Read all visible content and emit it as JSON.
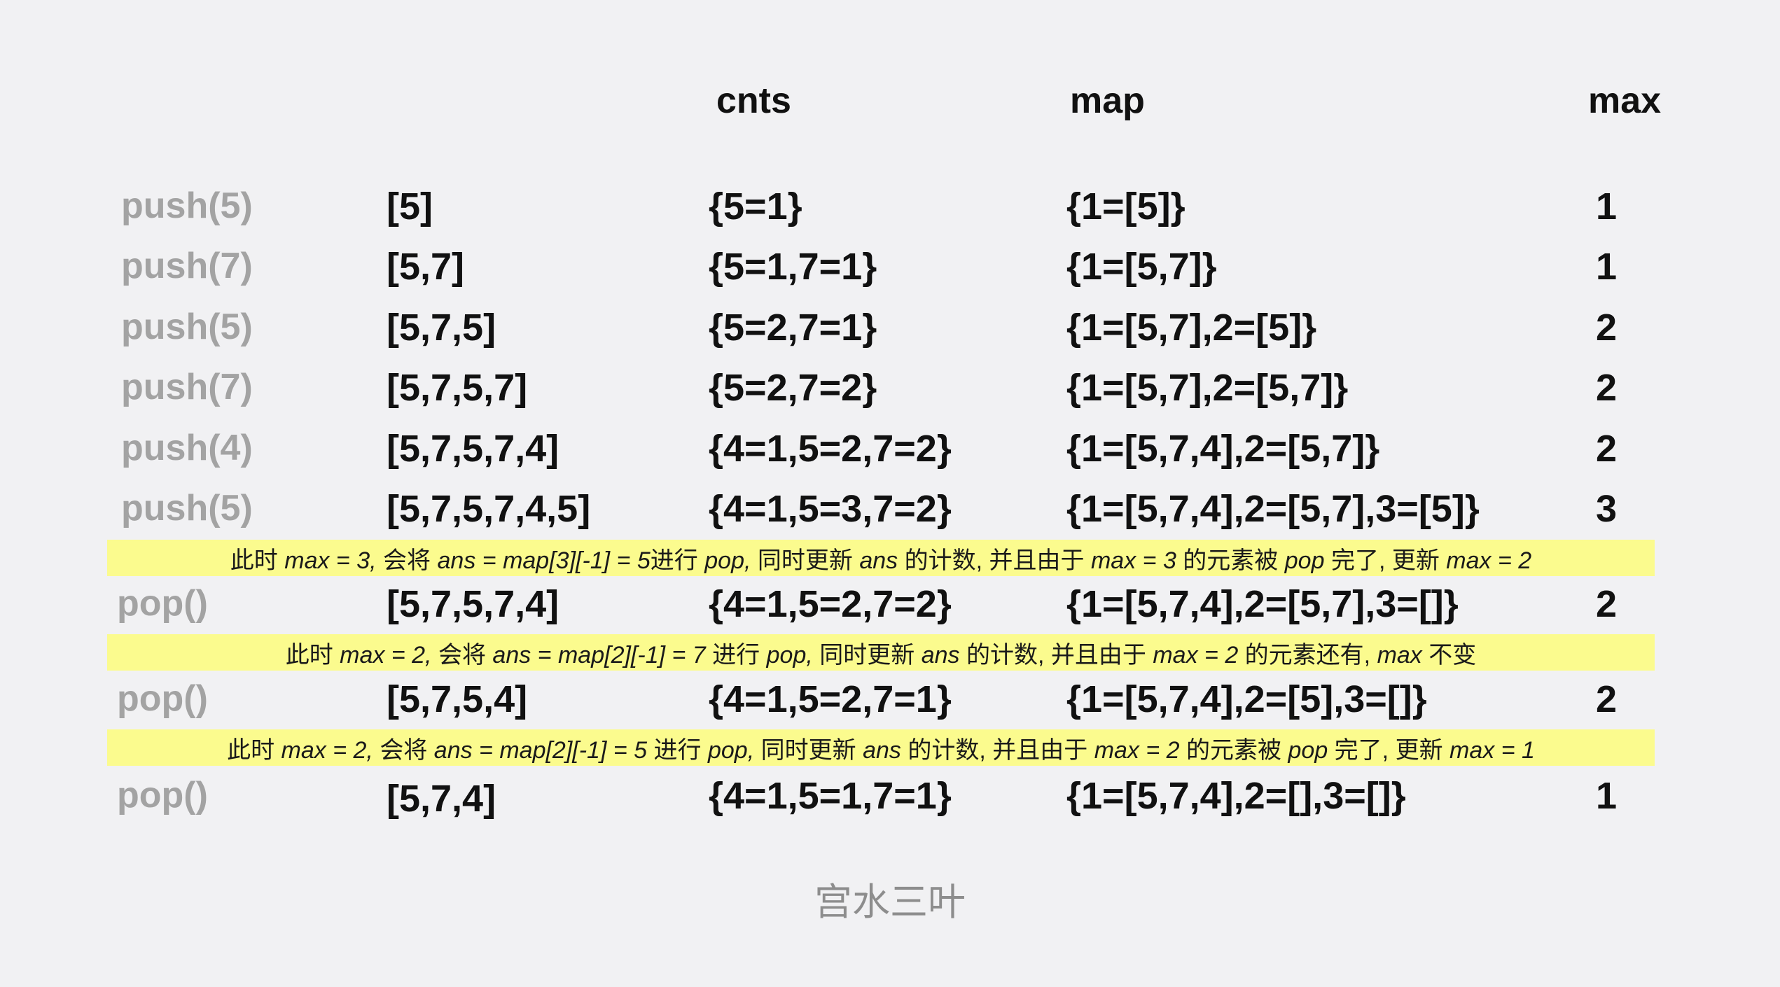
{
  "headers": {
    "cnts": "cnts",
    "map": "map",
    "max": "max"
  },
  "rows": [
    {
      "op": "push(5)",
      "stack": "[5]",
      "cnts": "{5=1}",
      "map": "{1=[5]}",
      "max": "1"
    },
    {
      "op": "push(7)",
      "stack": "[5,7]",
      "cnts": "{5=1,7=1}",
      "map": "{1=[5,7]}",
      "max": "1"
    },
    {
      "op": "push(5)",
      "stack": "[5,7,5]",
      "cnts": "{5=2,7=1}",
      "map": "{1=[5,7],2=[5]}",
      "max": "2"
    },
    {
      "op": "push(7)",
      "stack": "[5,7,5,7]",
      "cnts": "{5=2,7=2}",
      "map": "{1=[5,7],2=[5,7]}",
      "max": "2"
    },
    {
      "op": "push(4)",
      "stack": "[5,7,5,7,4]",
      "cnts": "{4=1,5=2,7=2}",
      "map": "{1=[5,7,4],2=[5,7]}",
      "max": "2"
    },
    {
      "op": "push(5)",
      "stack": "[5,7,5,7,4,5]",
      "cnts": "{4=1,5=3,7=2}",
      "map": "{1=[5,7,4],2=[5,7],3=[5]}",
      "max": "3"
    },
    {
      "op": "pop()",
      "stack": "[5,7,5,7,4]",
      "cnts": "{4=1,5=2,7=2}",
      "map": "{1=[5,7,4],2=[5,7],3=[]}",
      "max": "2"
    },
    {
      "op": "pop()",
      "stack": "[5,7,5,4]",
      "cnts": "{4=1,5=2,7=1}",
      "map": "{1=[5,7,4],2=[5],3=[]}",
      "max": "2"
    },
    {
      "op": "pop()",
      "stack": "[5,7,4]",
      "cnts": "{4=1,5=1,7=1}",
      "map": "{1=[5,7,4],2=[],3=[]}",
      "max": "1"
    }
  ],
  "notes": [
    {
      "parts": [
        {
          "text": "此时 ",
          "italic": false
        },
        {
          "text": "max = 3,",
          "italic": true
        },
        {
          "text": " 会将 ",
          "italic": false
        },
        {
          "text": "ans = map[3][-1] = 5",
          "italic": true
        },
        {
          "text": "进行 ",
          "italic": false
        },
        {
          "text": "pop,",
          "italic": true
        },
        {
          "text": " 同时更新 ",
          "italic": false
        },
        {
          "text": "ans",
          "italic": true
        },
        {
          "text": " 的计数, 并且由于 ",
          "italic": false
        },
        {
          "text": "max = 3",
          "italic": true
        },
        {
          "text": " 的元素被 ",
          "italic": false
        },
        {
          "text": "pop",
          "italic": true
        },
        {
          "text": " 完了, 更新 ",
          "italic": false
        },
        {
          "text": "max = 2",
          "italic": true
        }
      ]
    },
    {
      "parts": [
        {
          "text": "此时 ",
          "italic": false
        },
        {
          "text": "max = 2,",
          "italic": true
        },
        {
          "text": " 会将 ",
          "italic": false
        },
        {
          "text": "ans = map[2][-1] = 7",
          "italic": true
        },
        {
          "text": " 进行 ",
          "italic": false
        },
        {
          "text": "pop,",
          "italic": true
        },
        {
          "text": " 同时更新 ",
          "italic": false
        },
        {
          "text": "ans",
          "italic": true
        },
        {
          "text": " 的计数, 并且由于 ",
          "italic": false
        },
        {
          "text": "max = 2",
          "italic": true
        },
        {
          "text": " 的元素还有, ",
          "italic": false
        },
        {
          "text": "max",
          "italic": true
        },
        {
          "text": " 不变",
          "italic": false
        }
      ]
    },
    {
      "parts": [
        {
          "text": "此时 ",
          "italic": false
        },
        {
          "text": "max = 2,",
          "italic": true
        },
        {
          "text": " 会将 ",
          "italic": false
        },
        {
          "text": "ans = map[2][-1] = 5",
          "italic": true
        },
        {
          "text": " 进行 ",
          "italic": false
        },
        {
          "text": "pop,",
          "italic": true
        },
        {
          "text": " 同时更新 ",
          "italic": false
        },
        {
          "text": "ans",
          "italic": true
        },
        {
          "text": " 的计数, 并且由于 ",
          "italic": false
        },
        {
          "text": "max = 2",
          "italic": true
        },
        {
          "text": " 的元素被 ",
          "italic": false
        },
        {
          "text": "pop",
          "italic": true
        },
        {
          "text": " 完了, 更新 ",
          "italic": false
        },
        {
          "text": "max = 1",
          "italic": true
        }
      ]
    }
  ],
  "watermark": "宫水三叶",
  "colors": {
    "background": "#f1f1f3",
    "highlight": "#fbfb8e",
    "op_text": "#a3a3a3",
    "value_text": "#111111",
    "watermark": "#8d8d8d"
  }
}
